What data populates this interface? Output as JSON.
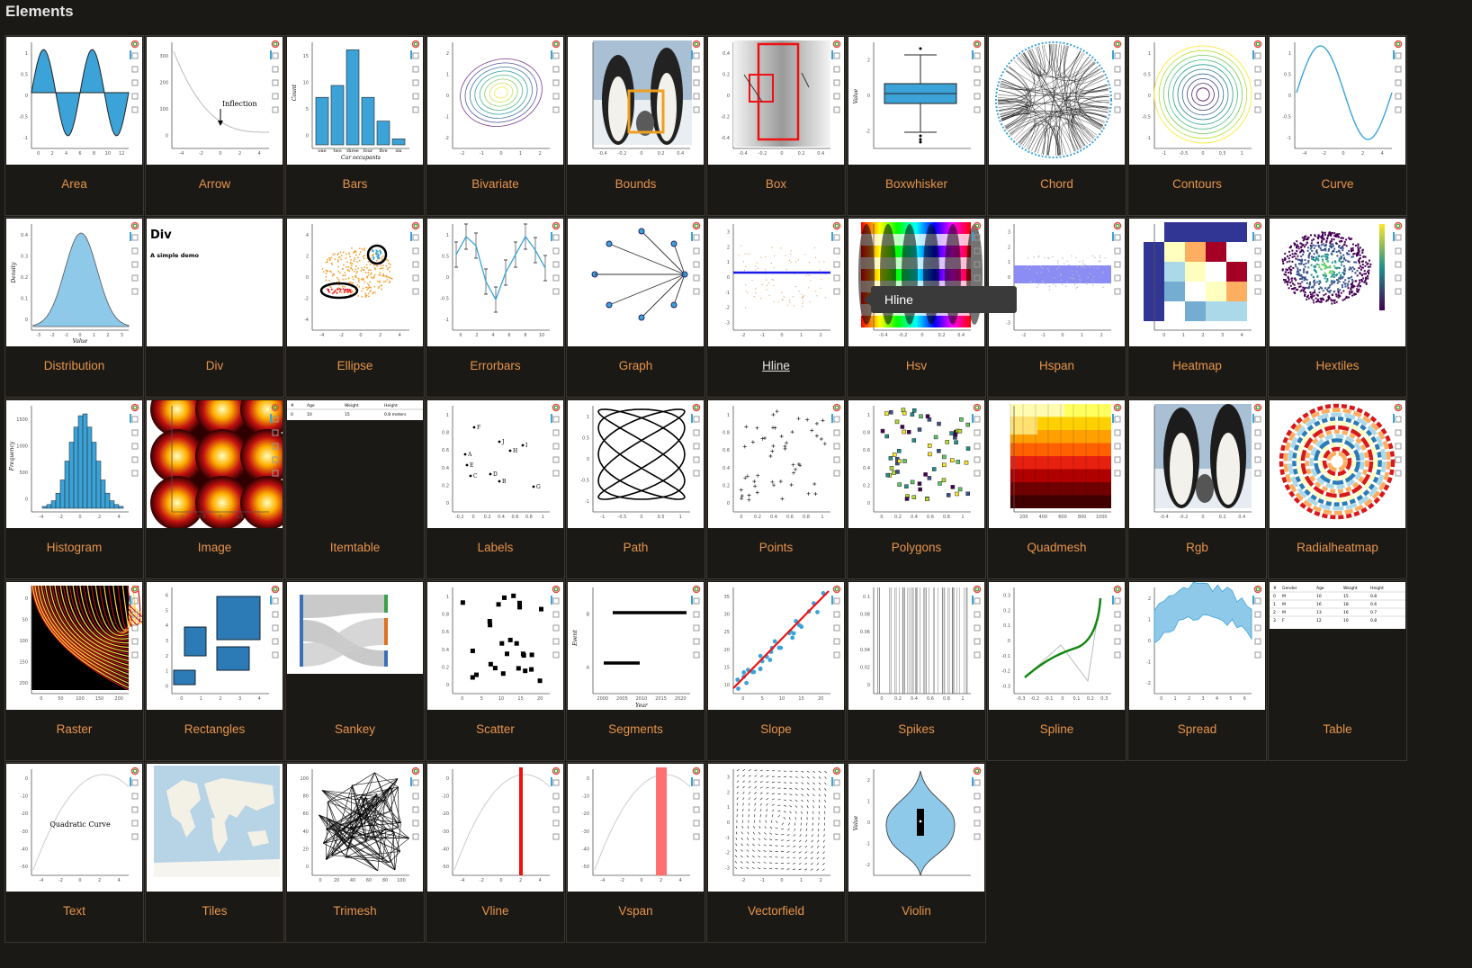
{
  "page_title": "Elements",
  "tooltip": "Hline",
  "hovered_item": "Hline",
  "accent_color": "#e6944a",
  "items": [
    {
      "label": "Area",
      "thumb": "area"
    },
    {
      "label": "Arrow",
      "thumb": "arrow",
      "annotation": "Inflection"
    },
    {
      "label": "Bars",
      "thumb": "bars",
      "categories": [
        "one",
        "two",
        "three",
        "four",
        "five",
        "six"
      ],
      "xlabel": "Car occupants",
      "ylabel": "Count"
    },
    {
      "label": "Bivariate",
      "thumb": "bivariate"
    },
    {
      "label": "Bounds",
      "thumb": "bounds"
    },
    {
      "label": "Box",
      "thumb": "box"
    },
    {
      "label": "Boxwhisker",
      "thumb": "boxwhisker",
      "ylabel": "Value"
    },
    {
      "label": "Chord",
      "thumb": "chord"
    },
    {
      "label": "Contours",
      "thumb": "contours"
    },
    {
      "label": "Curve",
      "thumb": "curve"
    },
    {
      "label": "Distribution",
      "thumb": "distribution",
      "xlabel": "Value",
      "ylabel": "Density"
    },
    {
      "label": "Div",
      "thumb": "div",
      "heading": "Div",
      "text": "A simple demo"
    },
    {
      "label": "Ellipse",
      "thumb": "ellipse"
    },
    {
      "label": "Errorbars",
      "thumb": "errorbars"
    },
    {
      "label": "Graph",
      "thumb": "graph"
    },
    {
      "label": "Hline",
      "thumb": "hline"
    },
    {
      "label": "Hsv",
      "thumb": "hsv"
    },
    {
      "label": "Hspan",
      "thumb": "hspan"
    },
    {
      "label": "Heatmap",
      "thumb": "heatmap"
    },
    {
      "label": "Hextiles",
      "thumb": "hextiles"
    },
    {
      "label": "Histogram",
      "thumb": "histogram",
      "ylabel": "Frequency"
    },
    {
      "label": "Image",
      "thumb": "image"
    },
    {
      "label": "Itemtable",
      "thumb": "itemtable",
      "columns": [
        "#",
        "Age",
        "Weight",
        "Height"
      ],
      "row": [
        "0",
        "10",
        "15",
        "0.8 meters"
      ]
    },
    {
      "label": "Labels",
      "thumb": "labels",
      "points": [
        "A",
        "B",
        "C",
        "D",
        "E",
        "F",
        "G",
        "H",
        "I",
        "J"
      ]
    },
    {
      "label": "Path",
      "thumb": "path"
    },
    {
      "label": "Points",
      "thumb": "points"
    },
    {
      "label": "Polygons",
      "thumb": "polygons"
    },
    {
      "label": "Quadmesh",
      "thumb": "quadmesh"
    },
    {
      "label": "Rgb",
      "thumb": "rgb"
    },
    {
      "label": "Radialheatmap",
      "thumb": "radialheatmap"
    },
    {
      "label": "Raster",
      "thumb": "raster"
    },
    {
      "label": "Rectangles",
      "thumb": "rectangles"
    },
    {
      "label": "Sankey",
      "thumb": "sankey"
    },
    {
      "label": "Scatter",
      "thumb": "scatter"
    },
    {
      "label": "Segments",
      "thumb": "segments",
      "xlabel": "Year",
      "ylabel": "Event"
    },
    {
      "label": "Slope",
      "thumb": "slope"
    },
    {
      "label": "Spikes",
      "thumb": "spikes"
    },
    {
      "label": "Spline",
      "thumb": "spline"
    },
    {
      "label": "Spread",
      "thumb": "spread"
    },
    {
      "label": "Table",
      "thumb": "table",
      "columns": [
        "#",
        "Gender",
        "Age",
        "Weight",
        "Height"
      ],
      "rows": [
        [
          "0",
          "M",
          "10",
          "15",
          "0.8"
        ],
        [
          "1",
          "M",
          "16",
          "18",
          "0.6"
        ],
        [
          "2",
          "M",
          "13",
          "16",
          "0.7"
        ],
        [
          "3",
          "F",
          "12",
          "10",
          "0.8"
        ]
      ]
    },
    {
      "label": "Text",
      "thumb": "text",
      "annotation": "Quadratic Curve"
    },
    {
      "label": "Tiles",
      "thumb": "tiles"
    },
    {
      "label": "Trimesh",
      "thumb": "trimesh"
    },
    {
      "label": "Vline",
      "thumb": "vline"
    },
    {
      "label": "Vspan",
      "thumb": "vspan"
    },
    {
      "label": "Vectorfield",
      "thumb": "vectorfield"
    },
    {
      "label": "Violin",
      "thumb": "violin",
      "ylabel": "Value"
    }
  ]
}
